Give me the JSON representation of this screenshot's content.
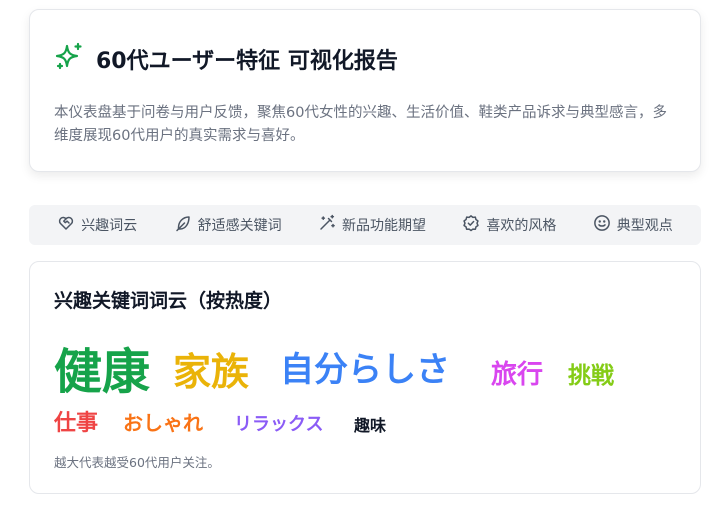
{
  "header": {
    "icon": "sparkles-icon",
    "title": "60代ユーザー特征 可视化报告",
    "description": "本仪表盘基于问卷与用户反馈，聚焦60代女性的兴趣、生活价值、鞋类产品诉求与典型感言，多维度展现60代用户的真实需求与喜好。"
  },
  "tabs": [
    {
      "label": "兴趣词云",
      "icon": "heart-handshake-icon"
    },
    {
      "label": "舒适感关键词",
      "icon": "feather-icon"
    },
    {
      "label": "新品功能期望",
      "icon": "magic-wand-icon"
    },
    {
      "label": "喜欢的风格",
      "icon": "check-badge-icon"
    },
    {
      "label": "典型观点",
      "icon": "smile-icon"
    }
  ],
  "wordcloud": {
    "title": "兴趣关键词词云（按热度）",
    "note": "越大代表越受60代用户关注。",
    "words": [
      {
        "text": "健康",
        "color": "#16a34a"
      },
      {
        "text": "家族",
        "color": "#eab308"
      },
      {
        "text": "自分らしさ",
        "color": "#3b82f6"
      },
      {
        "text": "旅行",
        "color": "#d946ef"
      },
      {
        "text": "挑戦",
        "color": "#84cc16"
      },
      {
        "text": "仕事",
        "color": "#ef4444"
      },
      {
        "text": "おしゃれ",
        "color": "#f97316"
      },
      {
        "text": "リラックス",
        "color": "#8b5cf6"
      },
      {
        "text": "趣味",
        "color": "#111827"
      }
    ]
  }
}
